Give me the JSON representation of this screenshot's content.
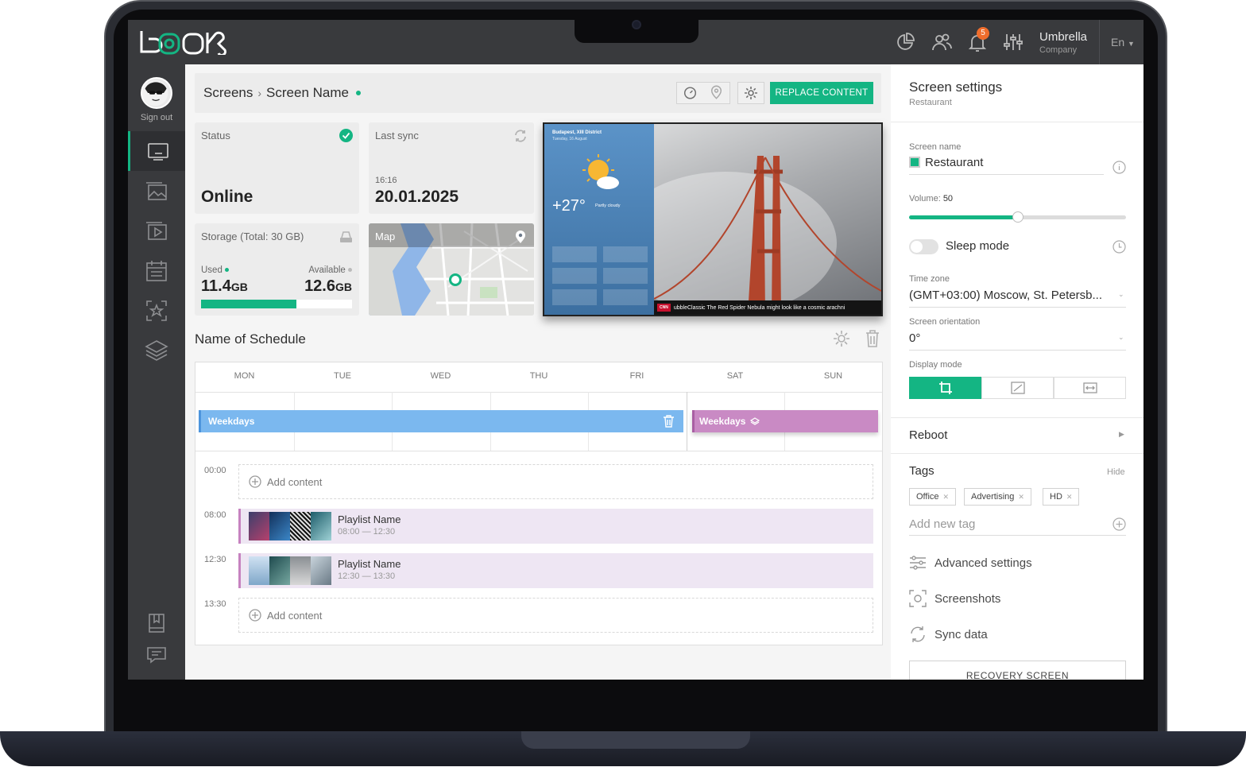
{
  "topbar": {
    "notification_count": "5",
    "company_name": "Umbrella",
    "company_sub": "Company",
    "language": "En"
  },
  "sidebar": {
    "sign_out": "Sign out",
    "items": [
      "screens",
      "gallery",
      "media",
      "schedule",
      "favorites",
      "layers",
      "docs",
      "messages"
    ]
  },
  "header": {
    "breadcrumb_root": "Screens",
    "breadcrumb_sep": "›",
    "breadcrumb_current": "Screen Name",
    "replace_button": "REPLACE CONTENT"
  },
  "status_card": {
    "label": "Status",
    "value": "Online"
  },
  "sync_card": {
    "label": "Last sync",
    "time": "16:16",
    "date": "20.01.2025"
  },
  "storage_card": {
    "label": "Storage (Total: 30 GB)",
    "used_label": "Used",
    "used_value": "11.4",
    "used_unit": "GB",
    "available_label": "Available",
    "available_value": "12.6",
    "available_unit": "GB",
    "used_fraction": 0.63
  },
  "map_card": {
    "label": "Map"
  },
  "preview": {
    "location": "Budapest, XIII District",
    "location_sub": "Tuesday, 16 August",
    "temperature": "+27°",
    "condition": "Partly cloudy",
    "ticker_brand": "CNN",
    "ticker_text": "ubbleClassic The Red Spider Nebula might look like a cosmic arachni"
  },
  "schedule": {
    "title": "Name of Schedule",
    "days": [
      "MON",
      "TUE",
      "WED",
      "THU",
      "FRI",
      "SAT",
      "SUN"
    ],
    "bar_weekdays": "Weekdays",
    "bar_weekend": "Weekdays",
    "rows": [
      {
        "time": "00:00",
        "type": "empty",
        "label": "Add content"
      },
      {
        "time": "08:00",
        "type": "playlist",
        "name": "Playlist Name",
        "range": "08:00 — 12:30"
      },
      {
        "time": "12:30",
        "type": "playlist",
        "name": "Playlist Name",
        "range": "12:30 — 13:30"
      },
      {
        "time": "13:30",
        "type": "empty",
        "label": "Add content"
      }
    ]
  },
  "settings": {
    "title": "Screen settings",
    "subtitle": "Restaurant",
    "screen_name_label": "Screen name",
    "screen_name_value": "Restaurant",
    "volume_label": "Volume:",
    "volume_value": "50",
    "volume_fraction": 0.5,
    "sleep_mode": "Sleep mode",
    "timezone_label": "Time zone",
    "timezone_value": "(GMT+03:00) Moscow, St. Petersb...",
    "orientation_label": "Screen orientation",
    "orientation_value": "0°",
    "display_mode_label": "Display mode",
    "reboot": "Reboot",
    "tags_label": "Tags",
    "tags_hide": "Hide",
    "tags": [
      "Office",
      "Advertising",
      "HD"
    ],
    "add_tag_placeholder": "Add new tag",
    "advanced": "Advanced settings",
    "screenshots": "Screenshots",
    "sync_data": "Sync data",
    "recovery": "RECOVERY SCREEN"
  },
  "colors": {
    "accent": "#14b583",
    "weekdays_bar": "#7bb8ef",
    "weekend_bar": "#c98ac4",
    "badge": "#f06d2c"
  }
}
